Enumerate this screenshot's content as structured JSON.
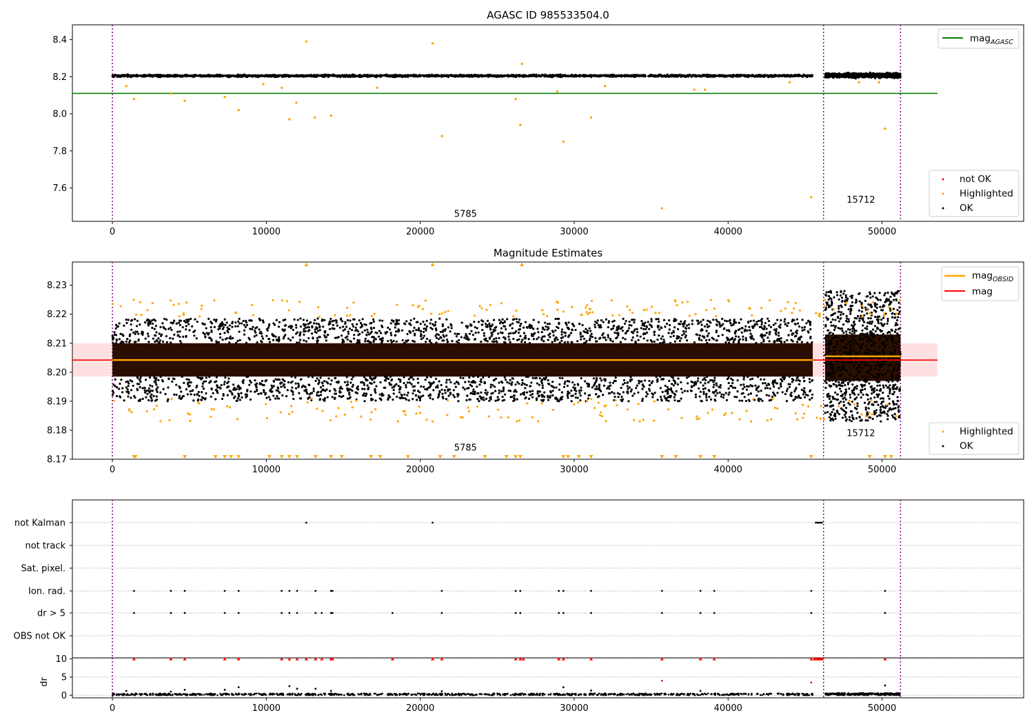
{
  "figure": {
    "title_top": "AGASC ID 985533504.0",
    "title_mid": "Magnitude Estimates"
  },
  "chart_data": [
    {
      "type": "scatter",
      "title": "AGASC ID 985533504.0",
      "xlabel": "",
      "ylabel": "",
      "xlim": [
        -2600,
        59200
      ],
      "ylim": [
        7.42,
        8.48
      ],
      "xticks": [
        0,
        10000,
        20000,
        30000,
        40000,
        50000
      ],
      "yticks": [
        7.6,
        7.8,
        8.0,
        8.2,
        8.4
      ],
      "vlines": [
        0,
        46200,
        51200
      ],
      "annotations": [
        {
          "text": "5785",
          "x": 22200,
          "y": 7.445
        },
        {
          "text": "15712",
          "x": 47700,
          "y": 7.52
        }
      ],
      "hline": {
        "name": "magAGASC",
        "y": 8.11,
        "x": [
          -2600,
          53600
        ],
        "color": "#008000"
      },
      "series": [
        {
          "name": "not OK",
          "color": "#ff0000",
          "points": []
        },
        {
          "name": "Highlighted",
          "color": "#ffa500",
          "points": [
            [
              12600,
              8.39
            ],
            [
              20800,
              8.38
            ],
            [
              26600,
              8.27
            ],
            [
              1400,
              8.08
            ],
            [
              4700,
              8.07
            ],
            [
              7300,
              8.09
            ],
            [
              8200,
              8.02
            ],
            [
              11500,
              7.97
            ],
            [
              11950,
              8.06
            ],
            [
              13150,
              7.98
            ],
            [
              14200,
              7.99
            ],
            [
              21400,
              7.88
            ],
            [
              26200,
              8.08
            ],
            [
              26500,
              7.94
            ],
            [
              29300,
              7.85
            ],
            [
              31100,
              7.98
            ],
            [
              50200,
              7.92
            ],
            [
              45400,
              7.55
            ],
            [
              35700,
              7.49
            ],
            [
              900,
              8.15
            ],
            [
              3800,
              8.11
            ],
            [
              11000,
              8.14
            ],
            [
              17200,
              8.14
            ],
            [
              28900,
              8.12
            ],
            [
              37800,
              8.13
            ],
            [
              38500,
              8.13
            ],
            [
              32000,
              8.15
            ],
            [
              48500,
              8.17
            ],
            [
              49800,
              8.17
            ],
            [
              44000,
              8.17
            ],
            [
              9800,
              8.16
            ]
          ]
        },
        {
          "name": "OK",
          "color": "#000000",
          "band": [
            {
              "x": [
                0,
                45500
              ],
              "y": [
                8.197,
                8.213
              ]
            },
            {
              "x": [
                46300,
                51200
              ],
              "y": [
                8.19,
                8.225
              ]
            }
          ]
        }
      ],
      "legend": [
        "magAGASC (top-right)",
        "not OK / Highlighted / OK (bottom-right)"
      ]
    },
    {
      "type": "scatter",
      "title": "Magnitude Estimates",
      "xlabel": "",
      "ylabel": "",
      "xlim": [
        -2600,
        59200
      ],
      "ylim": [
        8.17,
        8.238
      ],
      "xticks": [
        0,
        10000,
        20000,
        30000,
        40000,
        50000
      ],
      "yticks": [
        8.17,
        8.18,
        8.19,
        8.2,
        8.21,
        8.22,
        8.23
      ],
      "vlines": [
        0,
        46200,
        51200
      ],
      "annotations": [
        {
          "text": "5785",
          "x": 22200,
          "y": 8.173
        },
        {
          "text": "15712",
          "x": 47700,
          "y": 8.178
        }
      ],
      "mag_band": {
        "y": [
          8.1985,
          8.21
        ],
        "x": [
          -2600,
          53600
        ]
      },
      "lines": [
        {
          "name": "magOBSID",
          "color": "#ffa500",
          "segments": [
            {
              "x": [
                0,
                45500
              ],
              "y": 8.2042
            },
            {
              "x": [
                46300,
                51200
              ],
              "y": 8.2055
            }
          ]
        },
        {
          "name": "mag",
          "color": "#ff0000",
          "segments": [
            {
              "x": [
                -2600,
                53600
              ],
              "y": 8.2042
            }
          ]
        }
      ],
      "series": [
        {
          "name": "Highlighted",
          "color": "#ffa500",
          "clipped_low_x": [
            1400,
            1500,
            4700,
            6700,
            7300,
            7700,
            8200,
            10200,
            11000,
            11500,
            12000,
            13200,
            14200,
            14900,
            16800,
            17400,
            19200,
            21300,
            22200,
            24200,
            25600,
            26200,
            26500,
            29300,
            29600,
            30300,
            31100,
            35700,
            36600,
            38200,
            39100,
            45400,
            49200,
            50200,
            50600
          ]
        },
        {
          "name": "OK",
          "color": "#000000",
          "band": [
            {
              "x": [
                0,
                45500
              ],
              "y": [
                8.1985,
                8.21
              ]
            },
            {
              "x": [
                46300,
                51200
              ],
              "y": [
                8.197,
                8.213
              ]
            }
          ]
        }
      ],
      "legend": [
        "magOBSID / mag (top-right)",
        "Highlighted / OK (bottom-right)"
      ]
    },
    {
      "type": "scatter",
      "title": "",
      "xlabel": "",
      "ylabel": "",
      "categories": [
        "not Kalman",
        "not track",
        "Sat. pixel.",
        "Ion. rad.",
        "dr > 5",
        "OBS not OK"
      ],
      "xlim": [
        -2600,
        59200
      ],
      "flag_x": {
        "not Kalman": [
          12600,
          20800,
          45700,
          45800,
          45900,
          46000,
          46100
        ],
        "Ion. rad.": [
          1400,
          3800,
          4700,
          7300,
          8200,
          11000,
          11500,
          12000,
          13200,
          14200,
          14300,
          21400,
          26200,
          26500,
          29000,
          29300,
          31100,
          35700,
          38200,
          39100,
          45400,
          50200
        ],
        "dr > 5": [
          1400,
          3800,
          4700,
          7300,
          8200,
          11000,
          11500,
          12000,
          13200,
          13600,
          14200,
          14300,
          18200,
          21400,
          26200,
          26500,
          29000,
          29300,
          31100,
          35700,
          38200,
          39100,
          45400,
          50200
        ]
      },
      "vlines": [
        0,
        46200,
        51200
      ]
    },
    {
      "type": "scatter",
      "title": "",
      "xlabel": "",
      "ylabel": "dr",
      "xlim": [
        -2600,
        59200
      ],
      "ylim": [
        -0.7,
        10.3
      ],
      "xticks": [
        0,
        10000,
        20000,
        30000,
        40000,
        50000
      ],
      "yticks": [
        0,
        5,
        10
      ],
      "red_markers_y": 10,
      "red_markers_x": [
        1400,
        3800,
        4700,
        7300,
        8200,
        11000,
        11500,
        12000,
        12600,
        13200,
        13600,
        14200,
        14300,
        18200,
        20800,
        21400,
        26200,
        26500,
        26700,
        29000,
        29300,
        31100,
        35700,
        38200,
        39100,
        45400,
        45600,
        45700,
        45800,
        45900,
        46000,
        46100,
        50200
      ],
      "points": [
        [
          900,
          1.2
        ],
        [
          3800,
          1.0
        ],
        [
          4700,
          1.5
        ],
        [
          7300,
          1.5
        ],
        [
          8200,
          2.2
        ],
        [
          11500,
          2.5
        ],
        [
          12000,
          1.8
        ],
        [
          13200,
          1.8
        ],
        [
          14200,
          1.2
        ],
        [
          21400,
          1.1
        ],
        [
          29300,
          2.2
        ],
        [
          31100,
          1.3
        ],
        [
          35700,
          4.0
        ],
        [
          38200,
          1.2
        ],
        [
          45400,
          3.5
        ],
        [
          50200,
          2.7
        ]
      ],
      "vlines": [
        0,
        46200,
        51200
      ]
    }
  ]
}
